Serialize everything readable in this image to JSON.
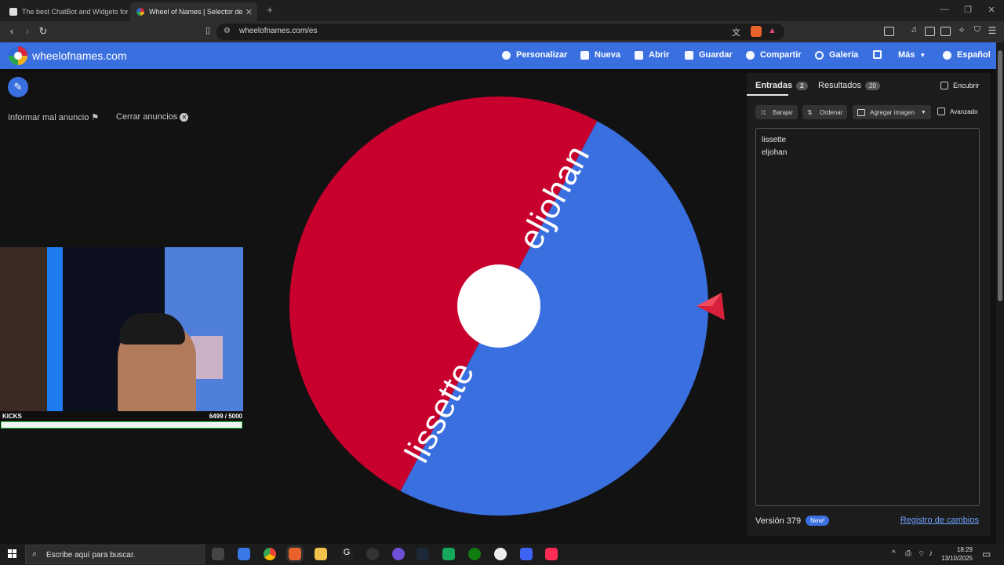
{
  "browser": {
    "tabs": [
      {
        "title": "The best ChatBot and Widgets for Ki",
        "active": false
      },
      {
        "title": "Wheel of Names | Selector de",
        "active": true
      }
    ],
    "url": "wheelofnames.com/es"
  },
  "site": {
    "title": "wheelofnames.com",
    "nav": [
      "Personalizar",
      "Nueva",
      "Abrir",
      "Guardar",
      "Compartir",
      "Galería",
      "Más",
      "Español"
    ]
  },
  "left": {
    "report_ad": "Informar mal anuncio",
    "close_ads": "Cerrar anuncios",
    "kicks_label": "KICKS",
    "kicks_count": "6499   / 5000",
    "kicks_progress": 1.0
  },
  "wheel": {
    "segments": [
      {
        "label": "eljohan",
        "color": "#c8002d"
      },
      {
        "label": "lissette",
        "color": "#3a6fe0"
      }
    ]
  },
  "panel": {
    "tab_entries": "Entradas",
    "tab_entries_count": "2",
    "tab_results": "Resultados",
    "tab_results_count": "20",
    "hide_label": "Encubrir",
    "shuffle": "Barajar",
    "sort": "Ordenar",
    "add_image": "Agregar imagen",
    "advanced": "Avanzado",
    "entries": [
      "lissette",
      "eljohan"
    ],
    "version": "Versión 379",
    "new_badge": "New!",
    "changelog": "Registro de cambios"
  },
  "taskbar": {
    "search_placeholder": "Escribe aquí para buscar.",
    "time": "18:29",
    "date": "13/10/2025"
  },
  "colors": {
    "brand_blue": "#3a6fe0",
    "wheel_red": "#c8002d",
    "pointer_red": "#d8203a"
  }
}
